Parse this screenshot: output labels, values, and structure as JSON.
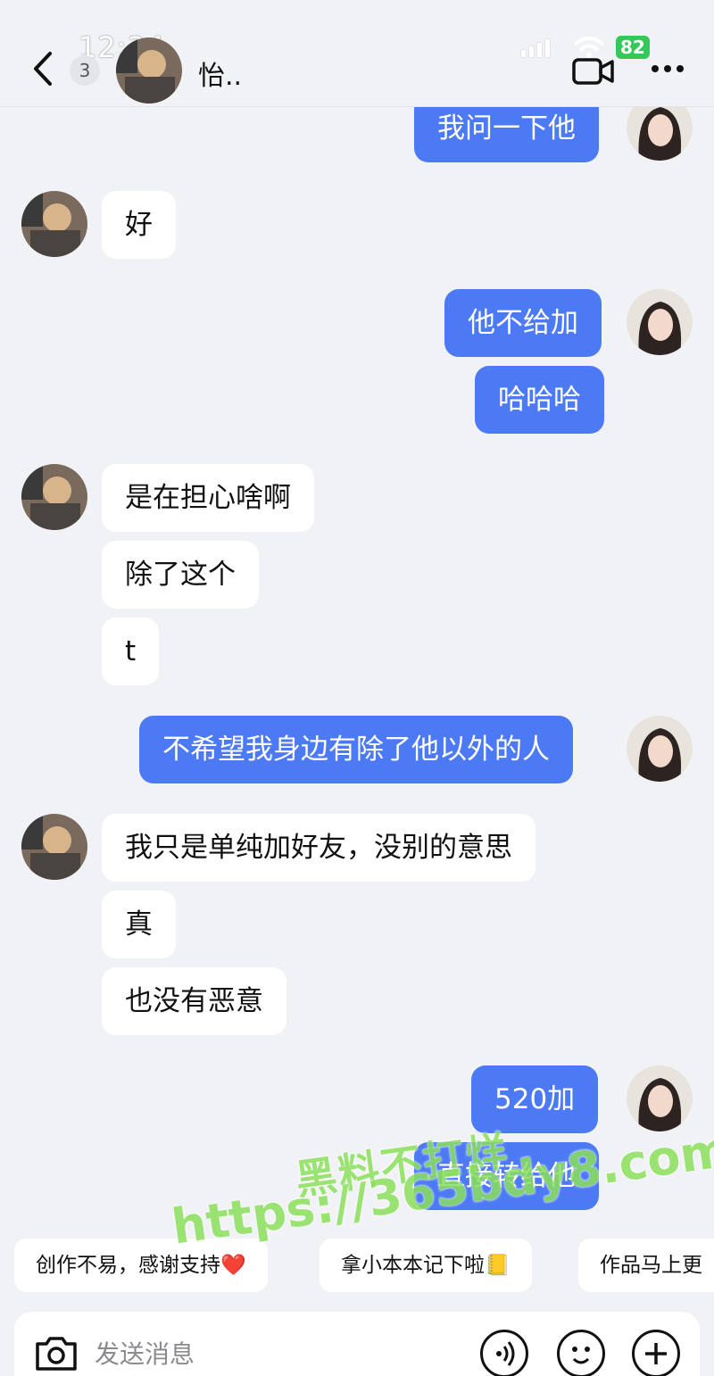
{
  "status": {
    "time": "12:34",
    "battery": "82"
  },
  "header": {
    "back_count": "3",
    "contact_name": "怡.."
  },
  "messages": [
    {
      "side": "out",
      "text": "我问一下他"
    },
    {
      "side": "in",
      "text": "好"
    },
    {
      "side": "out",
      "text": "他不给加"
    },
    {
      "side": "out",
      "text": "哈哈哈"
    },
    {
      "side": "in",
      "text": "是在担心啥啊"
    },
    {
      "side": "in",
      "text": "除了这个"
    },
    {
      "side": "in",
      "text": "t"
    },
    {
      "side": "out",
      "text": "不希望我身边有除了他以外的人"
    },
    {
      "side": "in",
      "text": "我只是单纯加好友，没别的意思"
    },
    {
      "side": "in",
      "text": "真"
    },
    {
      "side": "in",
      "text": "也没有恶意"
    },
    {
      "side": "out",
      "text": "520加"
    },
    {
      "side": "out",
      "text": "直接转给他"
    }
  ],
  "quick_replies": [
    "创作不易，感谢支持❤️",
    "拿小本本记下啦📒",
    "作品马上更"
  ],
  "input": {
    "placeholder": "发送消息"
  },
  "watermark": {
    "line1": "黑料不打烊",
    "line2": "https://365bdy8.com"
  },
  "colors": {
    "outgoing_bubble": "#4c7af4",
    "background": "#f1f2f6",
    "battery": "#34c759",
    "watermark": "#8be05b"
  },
  "icons": [
    "back-icon",
    "video-call-icon",
    "more-icon",
    "camera-icon",
    "voice-icon",
    "emoji-icon",
    "plus-icon"
  ]
}
